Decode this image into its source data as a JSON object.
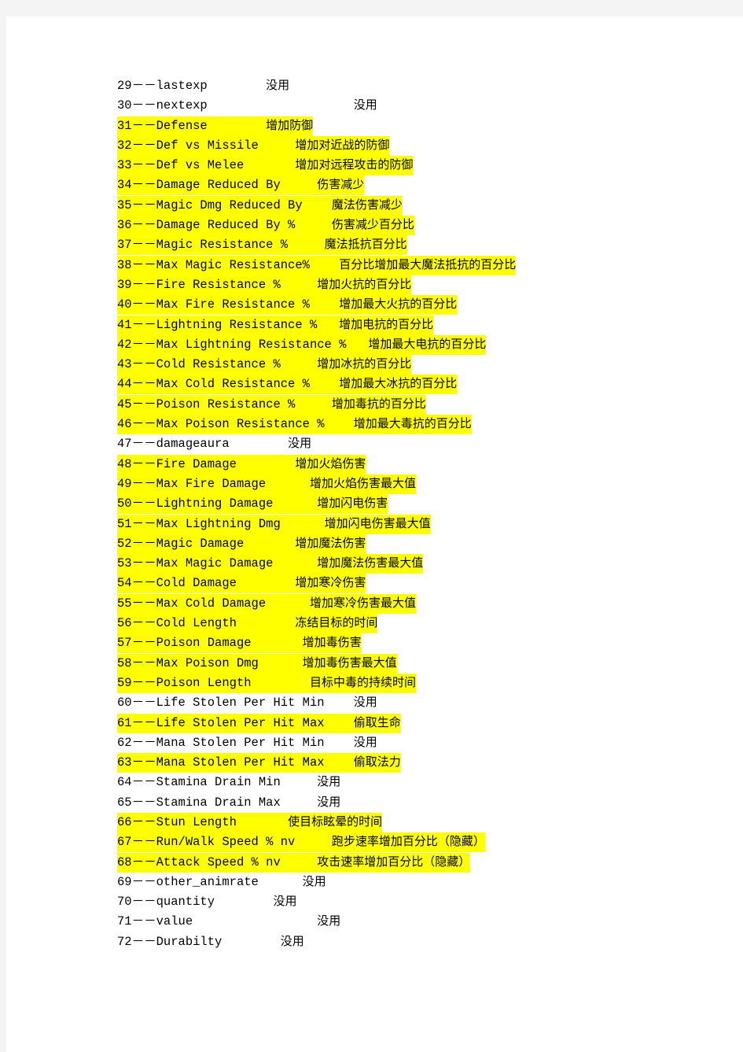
{
  "page": {
    "background_color": "#ffffff",
    "app_margin_color": "#f4f4f4",
    "highlight_color": "#ffff00",
    "text_color": "#000000"
  },
  "document": {
    "separator": "－－",
    "unused_label": "没用",
    "rows": [
      {
        "index": "29",
        "name": "lastexp",
        "gap": "        ",
        "desc": "没用",
        "highlighted": false
      },
      {
        "index": "30",
        "name": "nextexp",
        "gap": "                    ",
        "desc": "没用",
        "highlighted": false
      },
      {
        "index": "31",
        "name": "Defense",
        "gap": "        ",
        "desc": "增加防御",
        "highlighted": true
      },
      {
        "index": "32",
        "name": "Def vs Missile",
        "gap": "     ",
        "desc": "增加对近战的防御",
        "highlighted": true
      },
      {
        "index": "33",
        "name": "Def vs Melee",
        "gap": "       ",
        "desc": "增加对远程攻击的防御",
        "highlighted": true
      },
      {
        "index": "34",
        "name": "Damage Reduced By",
        "gap": "     ",
        "desc": "伤害减少",
        "highlighted": true
      },
      {
        "index": "35",
        "name": "Magic Dmg Reduced By",
        "gap": "    ",
        "desc": "魔法伤害减少",
        "highlighted": true
      },
      {
        "index": "36",
        "name": "Damage Reduced By %",
        "gap": "     ",
        "desc": "伤害减少百分比",
        "highlighted": true
      },
      {
        "index": "37",
        "name": "Magic Resistance %",
        "gap": "     ",
        "desc": "魔法抵抗百分比",
        "highlighted": true
      },
      {
        "index": "38",
        "name": "Max Magic Resistance%",
        "gap": "    ",
        "desc": "百分比增加最大魔法抵抗的百分比",
        "highlighted": true
      },
      {
        "index": "39",
        "name": "Fire Resistance %",
        "gap": "     ",
        "desc": "增加火抗的百分比",
        "highlighted": true
      },
      {
        "index": "40",
        "name": "Max Fire Resistance %",
        "gap": "    ",
        "desc": "增加最大火抗的百分比",
        "highlighted": true
      },
      {
        "index": "41",
        "name": "Lightning Resistance %",
        "gap": "   ",
        "desc": "增加电抗的百分比",
        "highlighted": true
      },
      {
        "index": "42",
        "name": "Max Lightning Resistance %",
        "gap": "   ",
        "desc": "增加最大电抗的百分比",
        "highlighted": true
      },
      {
        "index": "43",
        "name": "Cold Resistance %",
        "gap": "     ",
        "desc": "增加冰抗的百分比",
        "highlighted": true
      },
      {
        "index": "44",
        "name": "Max Cold Resistance %",
        "gap": "    ",
        "desc": "增加最大冰抗的百分比",
        "highlighted": true
      },
      {
        "index": "45",
        "name": "Poison Resistance %",
        "gap": "     ",
        "desc": "增加毒抗的百分比",
        "highlighted": true
      },
      {
        "index": "46",
        "name": "Max Poison Resistance %",
        "gap": "    ",
        "desc": "增加最大毒抗的百分比",
        "highlighted": true
      },
      {
        "index": "47",
        "name": "damageaura",
        "gap": "        ",
        "desc": "没用",
        "highlighted": false
      },
      {
        "index": "48",
        "name": "Fire Damage",
        "gap": "        ",
        "desc": "增加火焰伤害",
        "highlighted": true
      },
      {
        "index": "49",
        "name": "Max Fire Damage",
        "gap": "      ",
        "desc": "增加火焰伤害最大值",
        "highlighted": true
      },
      {
        "index": "50",
        "name": "Lightning Damage",
        "gap": "      ",
        "desc": "增加闪电伤害",
        "highlighted": true
      },
      {
        "index": "51",
        "name": "Max Lightning Dmg",
        "gap": "      ",
        "desc": "增加闪电伤害最大值",
        "highlighted": true
      },
      {
        "index": "52",
        "name": "Magic Damage",
        "gap": "       ",
        "desc": "增加魔法伤害",
        "highlighted": true
      },
      {
        "index": "53",
        "name": "Max Magic Damage",
        "gap": "      ",
        "desc": "增加魔法伤害最大值",
        "highlighted": true
      },
      {
        "index": "54",
        "name": "Cold Damage",
        "gap": "        ",
        "desc": "增加寒冷伤害",
        "highlighted": true
      },
      {
        "index": "55",
        "name": "Max Cold Damage",
        "gap": "      ",
        "desc": "增加寒冷伤害最大值",
        "highlighted": true
      },
      {
        "index": "56",
        "name": "Cold Length",
        "gap": "        ",
        "desc": "冻结目标的时间",
        "highlighted": true
      },
      {
        "index": "57",
        "name": "Poison Damage",
        "gap": "       ",
        "desc": "增加毒伤害",
        "highlighted": true
      },
      {
        "index": "58",
        "name": "Max Poison Dmg",
        "gap": "      ",
        "desc": "增加毒伤害最大值",
        "highlighted": true
      },
      {
        "index": "59",
        "name": "Poison Length",
        "gap": "        ",
        "desc": "目标中毒的持续时间",
        "highlighted": true
      },
      {
        "index": "60",
        "name": "Life Stolen Per Hit Min",
        "gap": "    ",
        "desc": "没用",
        "highlighted": false
      },
      {
        "index": "61",
        "name": "Life Stolen Per Hit Max",
        "gap": "    ",
        "desc": "偷取生命",
        "highlighted": true
      },
      {
        "index": "62",
        "name": "Mana Stolen Per Hit Min",
        "gap": "    ",
        "desc": "没用",
        "highlighted": false
      },
      {
        "index": "63",
        "name": "Mana Stolen Per Hit Max",
        "gap": "    ",
        "desc": "偷取法力",
        "highlighted": true
      },
      {
        "index": "64",
        "name": "Stamina Drain Min",
        "gap": "     ",
        "desc": "没用",
        "highlighted": false
      },
      {
        "index": "65",
        "name": "Stamina Drain Max",
        "gap": "     ",
        "desc": "没用",
        "highlighted": false
      },
      {
        "index": "66",
        "name": "Stun Length",
        "gap": "       ",
        "desc": "使目标眩晕的时间",
        "highlighted": true
      },
      {
        "index": "67",
        "name": "Run/Walk Speed % nv",
        "gap": "     ",
        "desc": "跑步速率增加百分比（隐藏）",
        "highlighted": true
      },
      {
        "index": "68",
        "name": "Attack Speed % nv",
        "gap": "     ",
        "desc": "攻击速率增加百分比（隐藏）",
        "highlighted": true
      },
      {
        "index": "69",
        "name": "other_animrate",
        "gap": "      ",
        "desc": "没用",
        "highlighted": false
      },
      {
        "index": "70",
        "name": "quantity",
        "gap": "        ",
        "desc": "没用",
        "highlighted": false
      },
      {
        "index": "71",
        "name": "value",
        "gap": "                 ",
        "desc": "没用",
        "highlighted": false
      },
      {
        "index": "72",
        "name": "Durabilty",
        "gap": "        ",
        "desc": "没用",
        "highlighted": false
      }
    ]
  }
}
